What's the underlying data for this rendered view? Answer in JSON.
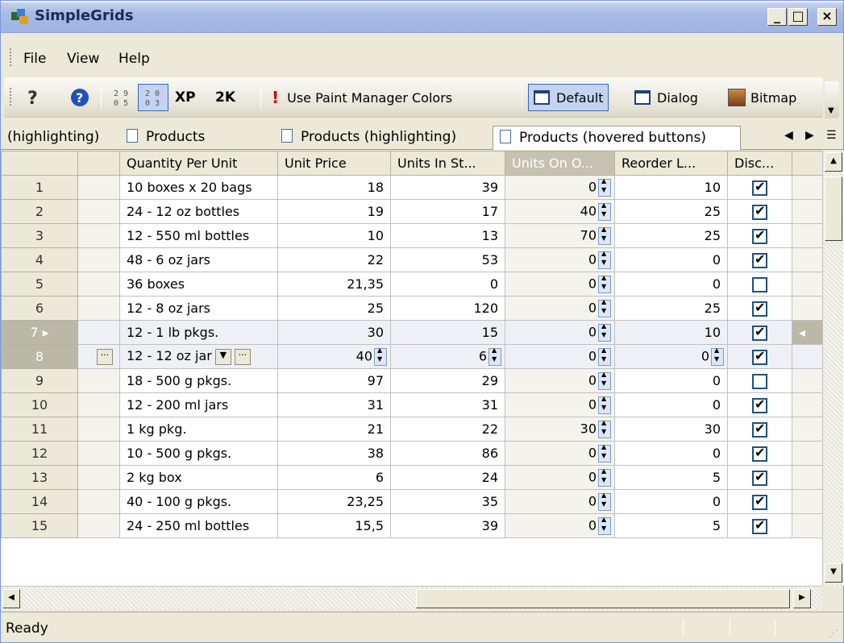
{
  "window": {
    "title": "SimpleGrids",
    "min_label": "_",
    "max_label": "□",
    "close_label": "×"
  },
  "menu": {
    "file": "File",
    "view": "View",
    "help": "Help"
  },
  "toolbar": {
    "xp": "XP",
    "k2": "2K",
    "use_paint_colors": "Use Paint Manager Colors",
    "default": "Default",
    "dialog": "Dialog",
    "bitmap": "Bitmap"
  },
  "tabs": [
    {
      "label": "(highlighting)"
    },
    {
      "label": "Products"
    },
    {
      "label": "Products (highlighting)"
    },
    {
      "label": "Products (hovered buttons)"
    }
  ],
  "grid": {
    "columns": [
      "",
      "",
      "Quantity Per Unit",
      "Unit Price",
      "Units In St...",
      "Units On O...",
      "Reorder L...",
      "Disc...",
      ""
    ],
    "rows": [
      {
        "n": "1",
        "qty": "10 boxes x 20 bags",
        "price": "18",
        "stock": "39",
        "onorder": "0",
        "reorder": "10",
        "disc": true
      },
      {
        "n": "2",
        "qty": "24 - 12 oz bottles",
        "price": "19",
        "stock": "17",
        "onorder": "40",
        "reorder": "25",
        "disc": true
      },
      {
        "n": "3",
        "qty": "12 - 550 ml bottles",
        "price": "10",
        "stock": "13",
        "onorder": "70",
        "reorder": "25",
        "disc": true
      },
      {
        "n": "4",
        "qty": "48 - 6 oz jars",
        "price": "22",
        "stock": "53",
        "onorder": "0",
        "reorder": "0",
        "disc": true
      },
      {
        "n": "5",
        "qty": "36 boxes",
        "price": "21,35",
        "stock": "0",
        "onorder": "0",
        "reorder": "0",
        "disc": false
      },
      {
        "n": "6",
        "qty": "12 - 8 oz jars",
        "price": "25",
        "stock": "120",
        "onorder": "0",
        "reorder": "25",
        "disc": true
      },
      {
        "n": "7",
        "qty": "12 - 1 lb pkgs.",
        "price": "30",
        "stock": "15",
        "onorder": "0",
        "reorder": "10",
        "disc": true
      },
      {
        "n": "8",
        "qty": "12 - 12 oz jar",
        "price": "40",
        "stock": "6",
        "onorder": "0",
        "reorder": "0",
        "disc": true
      },
      {
        "n": "9",
        "qty": "18 - 500 g pkgs.",
        "price": "97",
        "stock": "29",
        "onorder": "0",
        "reorder": "0",
        "disc": false
      },
      {
        "n": "10",
        "qty": "12 - 200 ml jars",
        "price": "31",
        "stock": "31",
        "onorder": "0",
        "reorder": "0",
        "disc": true
      },
      {
        "n": "11",
        "qty": "1 kg pkg.",
        "price": "21",
        "stock": "22",
        "onorder": "30",
        "reorder": "30",
        "disc": true
      },
      {
        "n": "12",
        "qty": "10 - 500 g pkgs.",
        "price": "38",
        "stock": "86",
        "onorder": "0",
        "reorder": "0",
        "disc": true
      },
      {
        "n": "13",
        "qty": "2 kg box",
        "price": "6",
        "stock": "24",
        "onorder": "0",
        "reorder": "5",
        "disc": true
      },
      {
        "n": "14",
        "qty": "40 - 100 g pkgs.",
        "price": "23,25",
        "stock": "35",
        "onorder": "0",
        "reorder": "0",
        "disc": true
      },
      {
        "n": "15",
        "qty": "24 - 250 ml bottles",
        "price": "15,5",
        "stock": "39",
        "onorder": "0",
        "reorder": "5",
        "disc": true
      }
    ]
  },
  "status": {
    "text": "Ready"
  }
}
